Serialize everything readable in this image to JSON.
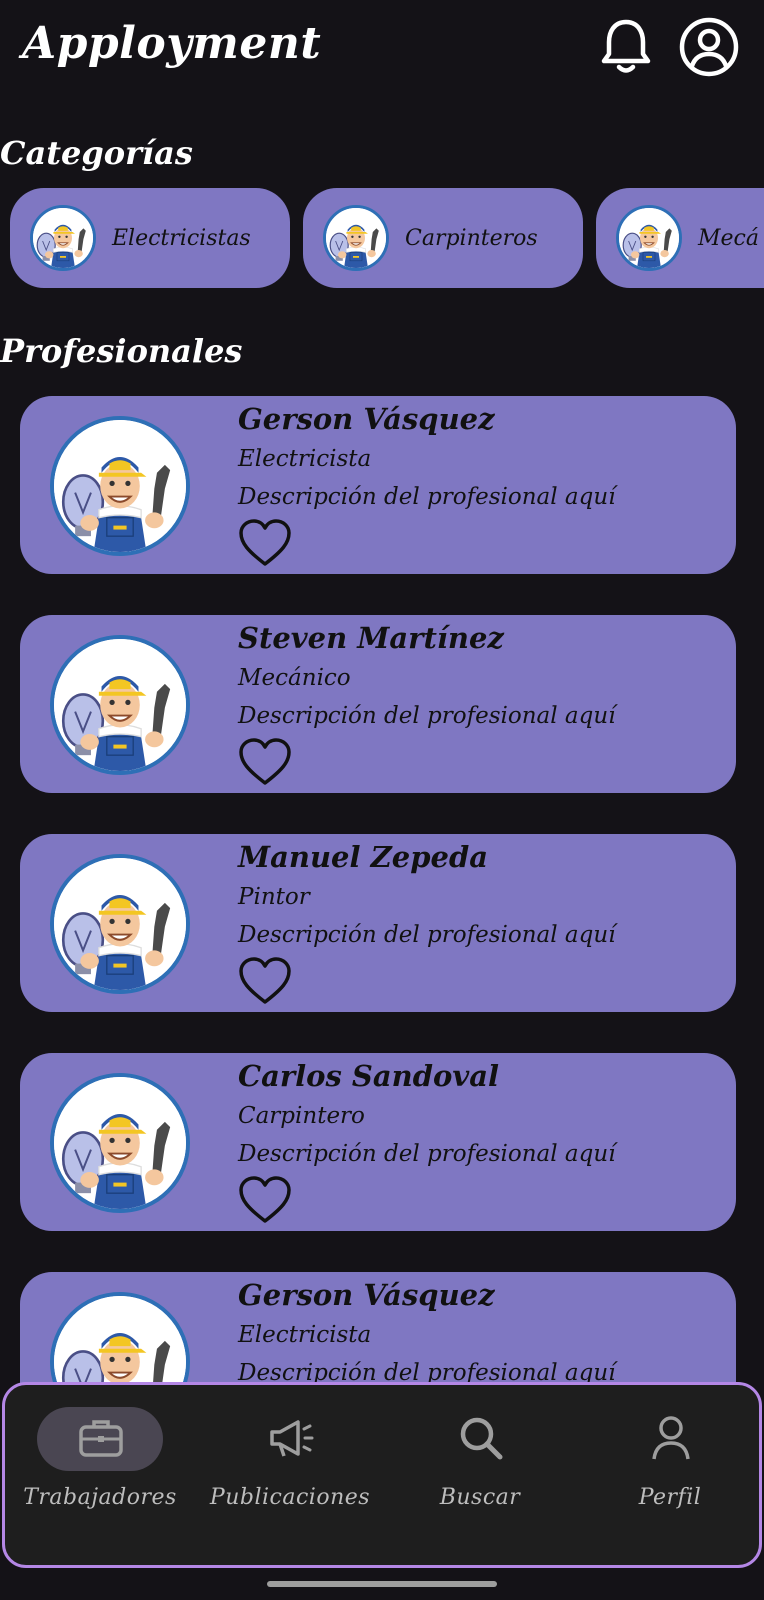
{
  "app": {
    "title": "Apployment"
  },
  "header": {
    "icons": [
      "bell-icon",
      "account-circle-icon"
    ]
  },
  "categories": {
    "title": "Categorías",
    "items": [
      {
        "label": "Electricistas",
        "icon": "worker-avatar"
      },
      {
        "label": "Carpinteros",
        "icon": "worker-avatar"
      },
      {
        "label": "Mecá",
        "icon": "worker-avatar"
      }
    ]
  },
  "professionals": {
    "title": "Profesionales",
    "items": [
      {
        "name": "Gerson Vásquez",
        "role": "Electricista",
        "description": "Descripción del profesional aquí"
      },
      {
        "name": "Steven Martínez",
        "role": "Mecánico",
        "description": "Descripción del profesional aquí"
      },
      {
        "name": "Manuel Zepeda",
        "role": "Pintor",
        "description": "Descripción del profesional aquí"
      },
      {
        "name": "Carlos Sandoval",
        "role": "Carpintero",
        "description": "Descripción del profesional aquí"
      },
      {
        "name": "Gerson Vásquez",
        "role": "Electricista",
        "description": "Descripción del profesional aquí"
      }
    ]
  },
  "bottom_nav": {
    "items": [
      {
        "label": "Trabajadores",
        "icon": "briefcase-icon",
        "active": true
      },
      {
        "label": "Publicaciones",
        "icon": "megaphone-icon",
        "active": false
      },
      {
        "label": "Buscar",
        "icon": "search-icon",
        "active": false
      },
      {
        "label": "Perfil",
        "icon": "person-icon",
        "active": false
      }
    ]
  },
  "colors": {
    "background": "#141217",
    "card": "#7f77c2",
    "nav_background": "#1e1e1e",
    "nav_border": "#b487e6",
    "active_pill": "#4a4652"
  }
}
